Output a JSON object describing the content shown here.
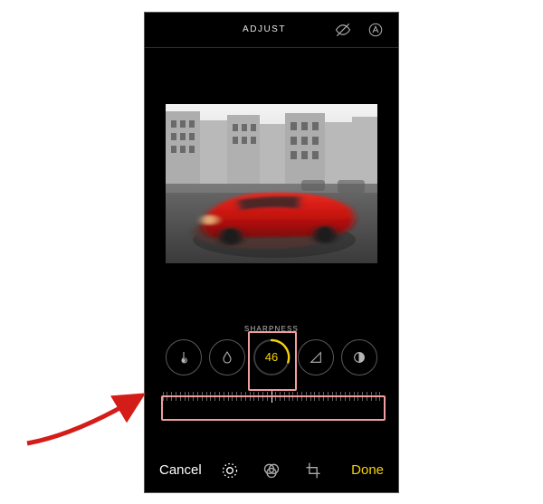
{
  "header": {
    "title": "ADJUST"
  },
  "adjustment": {
    "label": "SHARPNESS",
    "value": "46"
  },
  "footer": {
    "cancel": "Cancel",
    "done": "Done"
  },
  "colors": {
    "accent": "#f5d20a",
    "highlight": "#f29da0",
    "arrow": "#d41c19"
  }
}
